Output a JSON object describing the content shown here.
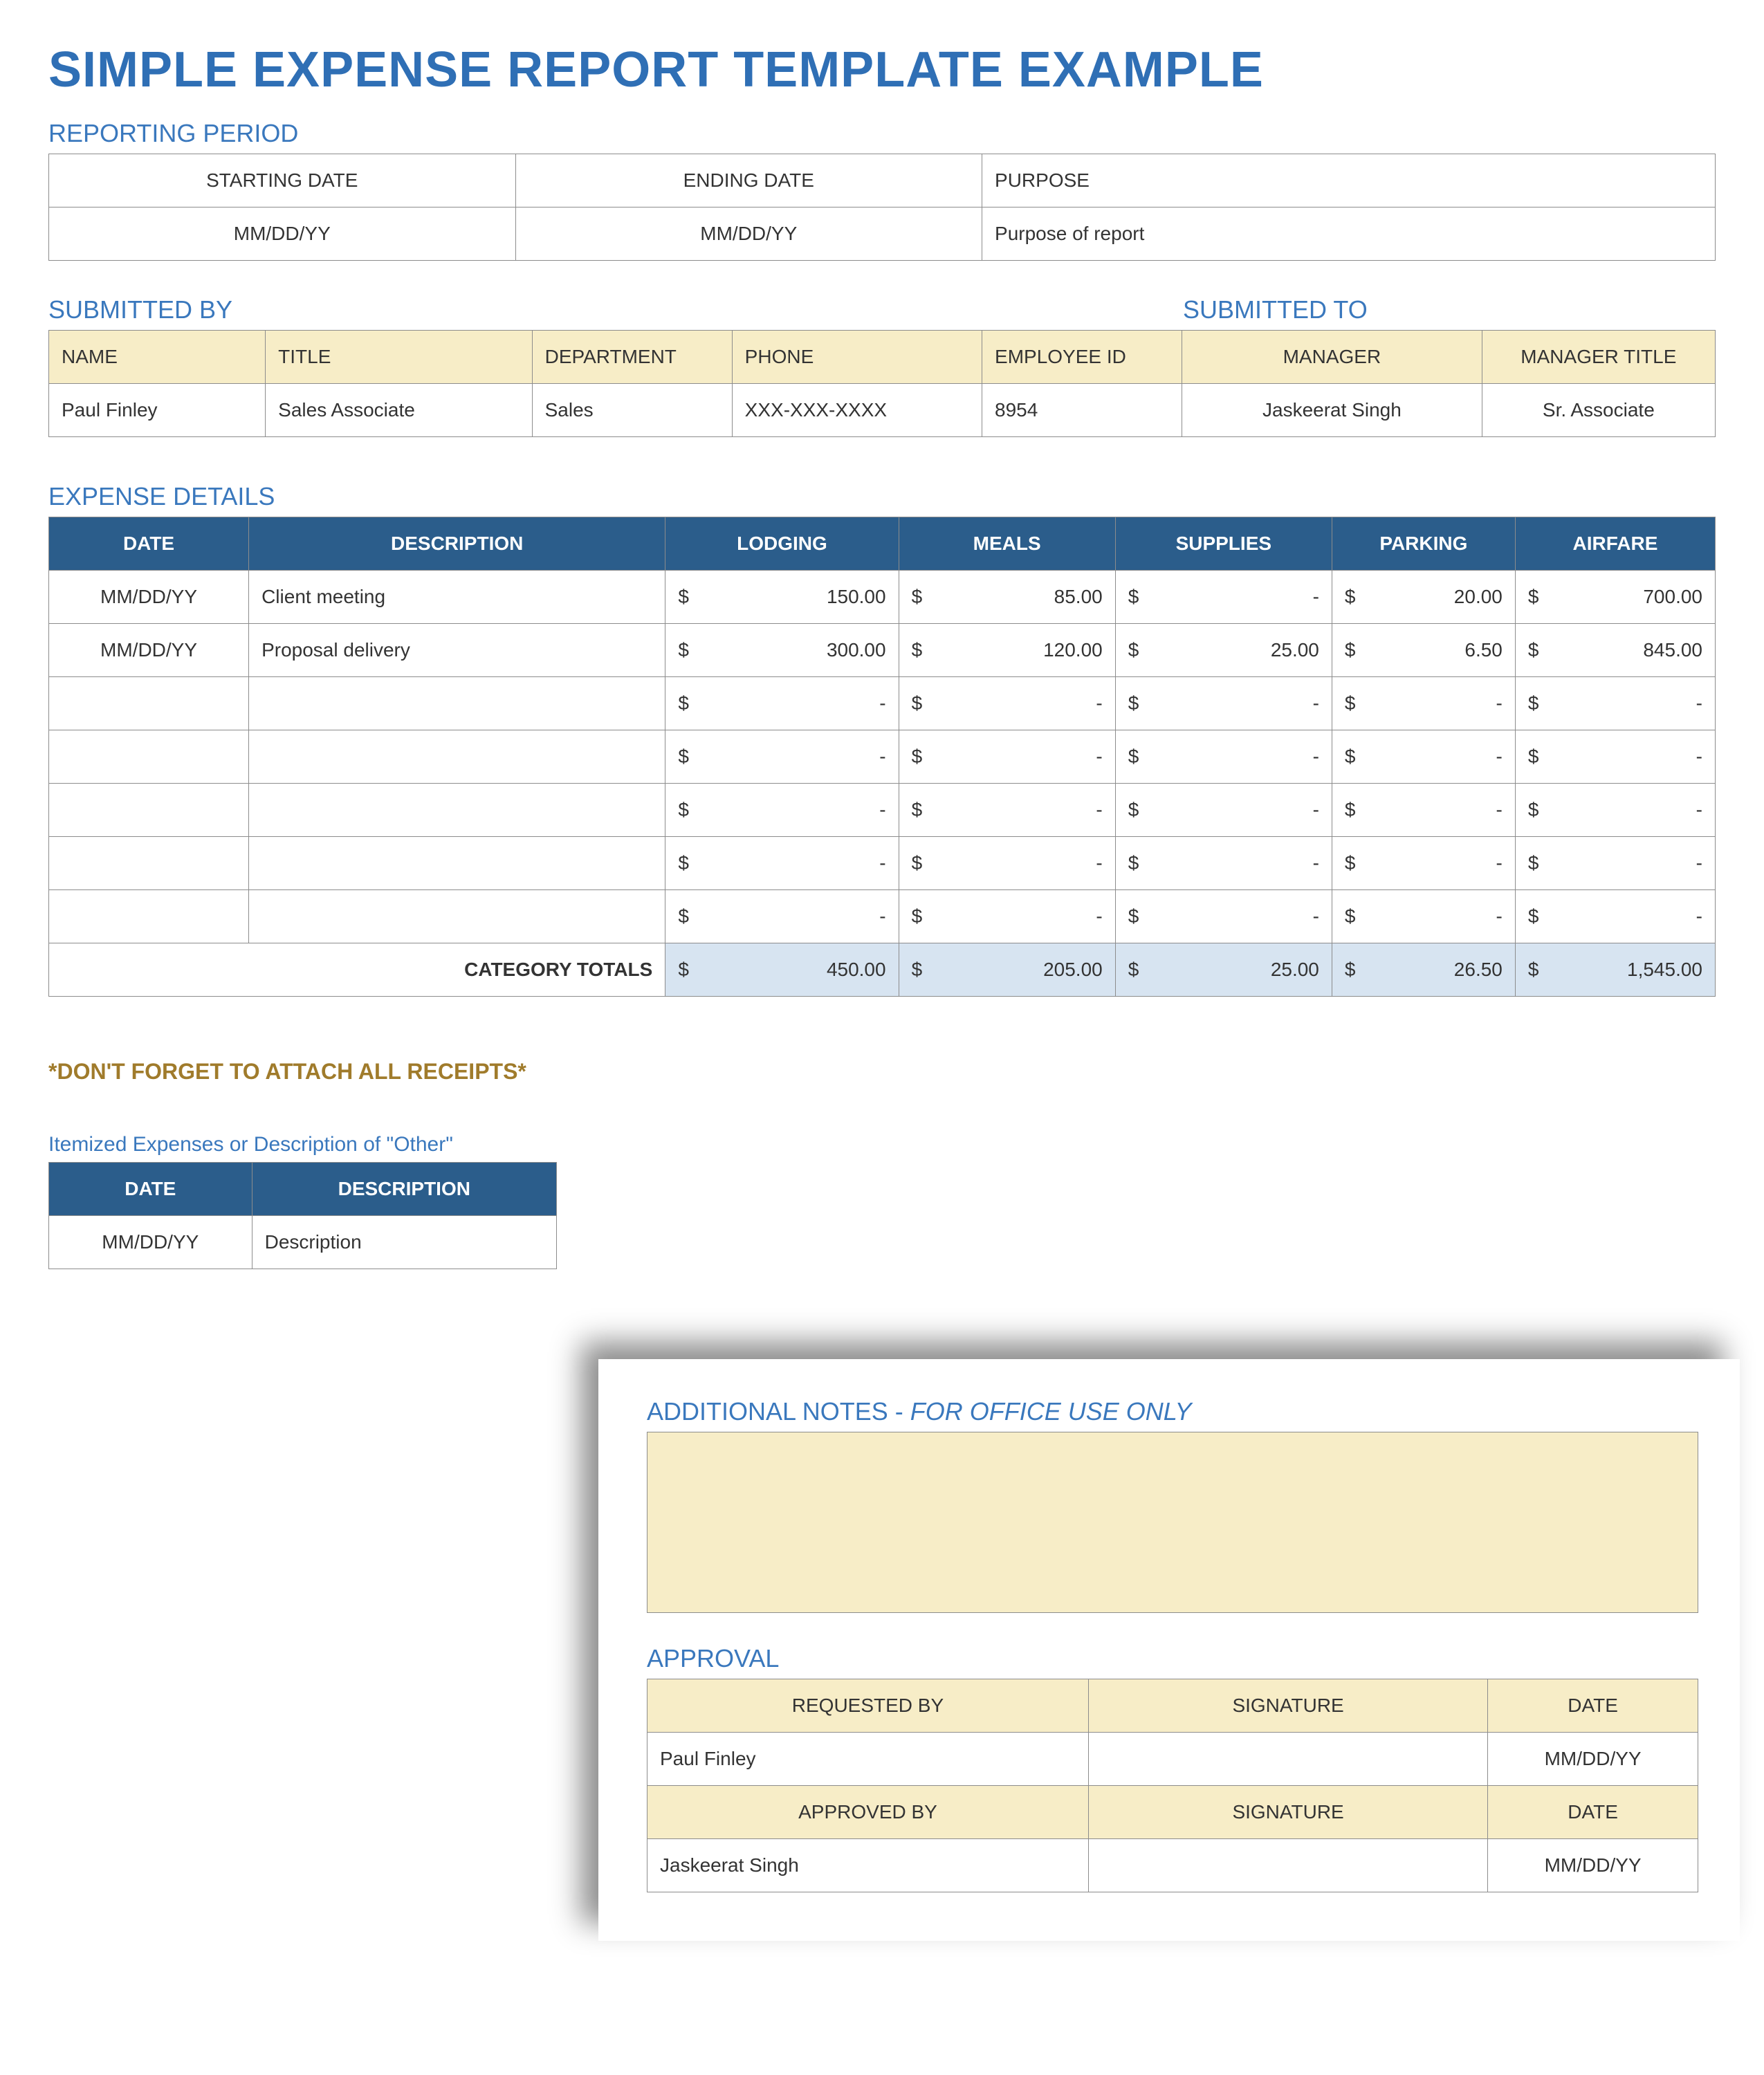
{
  "title": "SIMPLE EXPENSE REPORT TEMPLATE EXAMPLE",
  "period": {
    "label": "REPORTING PERIOD",
    "headers": [
      "STARTING DATE",
      "ENDING DATE",
      "PURPOSE"
    ],
    "values": [
      "MM/DD/YY",
      "MM/DD/YY",
      "Purpose of report"
    ]
  },
  "submitted": {
    "by_label": "SUBMITTED BY",
    "to_label": "SUBMITTED TO",
    "headers": [
      "NAME",
      "TITLE",
      "DEPARTMENT",
      "PHONE",
      "EMPLOYEE ID",
      "MANAGER",
      "MANAGER TITLE"
    ],
    "values": [
      "Paul Finley",
      "Sales Associate",
      "Sales",
      "XXX-XXX-XXXX",
      "8954",
      "Jaskeerat Singh",
      "Sr. Associate"
    ]
  },
  "details": {
    "label": "EXPENSE DETAILS",
    "headers": [
      "DATE",
      "DESCRIPTION",
      "LODGING",
      "MEALS",
      "SUPPLIES",
      "PARKING",
      "AIRFARE"
    ],
    "rows": [
      {
        "date": "MM/DD/YY",
        "desc": "Client meeting",
        "lodging": "150.00",
        "meals": "85.00",
        "supplies": "-",
        "parking": "20.00",
        "airfare": "700.00"
      },
      {
        "date": "MM/DD/YY",
        "desc": "Proposal delivery",
        "lodging": "300.00",
        "meals": "120.00",
        "supplies": "25.00",
        "parking": "6.50",
        "airfare": "845.00"
      },
      {
        "date": "",
        "desc": "",
        "lodging": "-",
        "meals": "-",
        "supplies": "-",
        "parking": "-",
        "airfare": "-"
      },
      {
        "date": "",
        "desc": "",
        "lodging": "-",
        "meals": "-",
        "supplies": "-",
        "parking": "-",
        "airfare": "-"
      },
      {
        "date": "",
        "desc": "",
        "lodging": "-",
        "meals": "-",
        "supplies": "-",
        "parking": "-",
        "airfare": "-"
      },
      {
        "date": "",
        "desc": "",
        "lodging": "-",
        "meals": "-",
        "supplies": "-",
        "parking": "-",
        "airfare": "-"
      },
      {
        "date": "",
        "desc": "",
        "lodging": "-",
        "meals": "-",
        "supplies": "-",
        "parking": "-",
        "airfare": "-"
      }
    ],
    "totals_label": "CATEGORY TOTALS",
    "totals": {
      "lodging": "450.00",
      "meals": "205.00",
      "supplies": "25.00",
      "parking": "26.50",
      "airfare": "1,545.00"
    },
    "currency": "$"
  },
  "receipts_note": "*DON'T FORGET TO ATTACH ALL RECEIPTS*",
  "itemized": {
    "label": "Itemized Expenses or Description of \"Other\"",
    "headers": [
      "DATE",
      "DESCRIPTION"
    ],
    "row": {
      "date": "MM/DD/YY",
      "desc": "Description"
    }
  },
  "overlay": {
    "notes_label_a": "ADDITIONAL NOTES - ",
    "notes_label_b": "FOR OFFICE USE ONLY",
    "approval_label": "APPROVAL",
    "headers1": [
      "REQUESTED BY",
      "SIGNATURE",
      "DATE"
    ],
    "row1": [
      "Paul Finley",
      "",
      "MM/DD/YY"
    ],
    "headers2": [
      "APPROVED BY",
      "SIGNATURE",
      "DATE"
    ],
    "row2": [
      "Jaskeerat Singh",
      "",
      "MM/DD/YY"
    ]
  }
}
